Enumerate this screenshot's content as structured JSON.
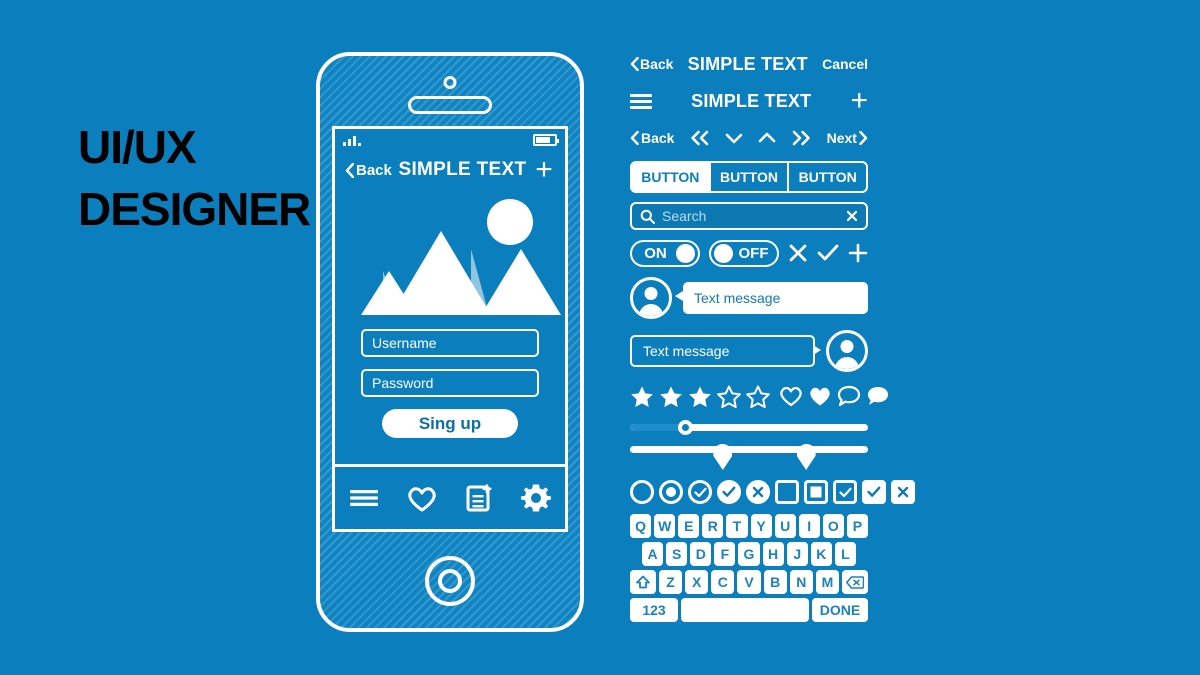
{
  "theme": {
    "background": "#0b7fbd",
    "ink": "#ffffff",
    "title_color": "#000000",
    "accent_on_white": "#1079b5"
  },
  "title": {
    "line1": "UI/UX",
    "line2": "DESIGNER"
  },
  "phone": {
    "status": {
      "signal_icon": "signal-bars-icon",
      "battery_icon": "battery-icon"
    },
    "nav": {
      "back_label": "Back",
      "title": "SIMPLE TEXT",
      "add_label": "+"
    },
    "hero": {
      "sun_icon": "sun-icon",
      "mountain_icon": "mountain-icon"
    },
    "form": {
      "username_placeholder": "Username",
      "password_placeholder": "Password",
      "signup_label": "Sing up"
    },
    "tabbar": [
      {
        "icon": "menu-icon"
      },
      {
        "icon": "heart-icon"
      },
      {
        "icon": "document-add-icon"
      },
      {
        "icon": "gear-icon"
      }
    ],
    "home_button_icon": "home-button-icon"
  },
  "kit": {
    "navbar_cancel": {
      "back_label": "Back",
      "title": "SIMPLE TEXT",
      "cancel_label": "Cancel"
    },
    "navbar_menu": {
      "menu_icon": "hamburger-icon",
      "title": "SIMPLE TEXT",
      "add_label": "+"
    },
    "pager": {
      "back_label": "Back",
      "first_icon": "double-chevron-left-icon",
      "down_icon": "chevron-down-icon",
      "up_icon": "chevron-up-icon",
      "last_icon": "double-chevron-right-icon",
      "next_label": "Next"
    },
    "segmented": {
      "options": [
        "BUTTON",
        "BUTTON",
        "BUTTON"
      ],
      "selected_index": 0
    },
    "search": {
      "icon": "search-icon",
      "placeholder": "Search",
      "clear_icon": "clear-x-icon"
    },
    "toggles": {
      "on_label": "ON",
      "off_label": "OFF",
      "close_icon": "x-icon",
      "check_icon": "check-icon",
      "plus_icon": "plus-icon"
    },
    "messages": {
      "incoming_text": "Text message",
      "outgoing_text": "Text message",
      "avatar_icon": "user-avatar-icon"
    },
    "rating": {
      "stars_total": 5,
      "stars_filled": 3,
      "heart_outline_icon": "heart-outline-icon",
      "heart_filled_icon": "heart-filled-icon",
      "comment_outline_icon": "comment-outline-icon",
      "comment_filled_icon": "comment-filled-icon"
    },
    "sliders": {
      "single_value_percent": 22,
      "range_low_percent": 35,
      "range_high_percent": 70
    },
    "controls": [
      {
        "name": "radio-empty",
        "shape": "circle",
        "state": "empty"
      },
      {
        "name": "radio-selected",
        "shape": "circle",
        "state": "dot"
      },
      {
        "name": "check-circle-outline",
        "shape": "circle",
        "state": "check"
      },
      {
        "name": "check-circle-filled",
        "shape": "circle",
        "state": "check-filled"
      },
      {
        "name": "close-circle-filled",
        "shape": "circle",
        "state": "x-filled"
      },
      {
        "name": "checkbox-empty",
        "shape": "square",
        "state": "empty"
      },
      {
        "name": "checkbox-indeterminate",
        "shape": "square",
        "state": "dot"
      },
      {
        "name": "checkbox-outline-check",
        "shape": "square",
        "state": "check"
      },
      {
        "name": "checkbox-filled-check",
        "shape": "square",
        "state": "check-filled"
      },
      {
        "name": "checkbox-filled-close",
        "shape": "square",
        "state": "x-filled"
      }
    ],
    "keyboard": {
      "row1": [
        "Q",
        "W",
        "E",
        "R",
        "T",
        "Y",
        "U",
        "I",
        "O",
        "P"
      ],
      "row2": [
        "A",
        "S",
        "D",
        "F",
        "G",
        "H",
        "J",
        "K",
        "L"
      ],
      "row3": [
        "Z",
        "X",
        "C",
        "V",
        "B",
        "N",
        "M"
      ],
      "shift_icon": "shift-icon",
      "backspace_icon": "backspace-icon",
      "numeric_label": "123",
      "space_label": "",
      "done_label": "DONE"
    }
  }
}
